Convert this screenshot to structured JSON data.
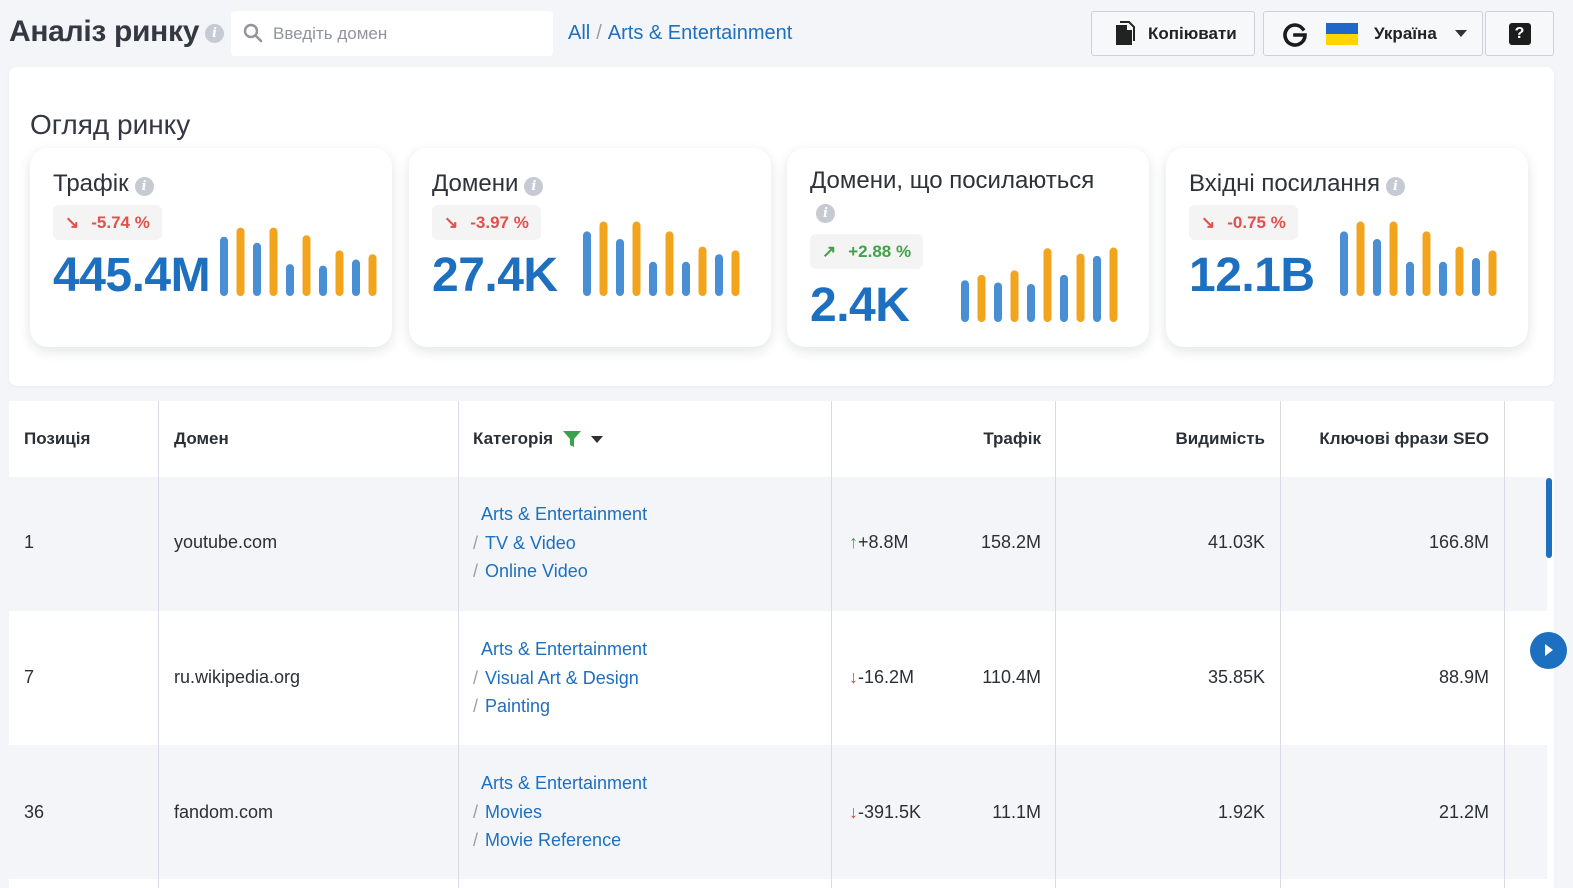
{
  "header": {
    "title": "Аналіз ринку",
    "search_placeholder": "Введіть домен",
    "breadcrumb": [
      "All",
      "Arts & Entertainment"
    ],
    "copy_label": "Копіювати",
    "region_label": "Україна",
    "help_label": "?"
  },
  "overview": {
    "title": "Огляд ринку",
    "cards": [
      {
        "title": "Трафік",
        "delta": "-5.74 %",
        "direction": "down",
        "value": "445.4M",
        "bars": [
          0.78,
          0.9,
          0.7,
          0.9,
          0.42,
          0.8,
          0.4,
          0.6,
          0.48,
          0.55
        ]
      },
      {
        "title": "Домени",
        "delta": "-3.97 %",
        "direction": "down",
        "value": "27.4K",
        "bars": [
          0.85,
          0.98,
          0.75,
          0.98,
          0.45,
          0.85,
          0.45,
          0.65,
          0.55,
          0.6
        ]
      },
      {
        "title": "Домени, що посилаються",
        "delta": "+2.88 %",
        "direction": "up",
        "value": "2.4K",
        "bars": [
          0.55,
          0.62,
          0.52,
          0.68,
          0.5,
          0.97,
          0.62,
          0.9,
          0.87,
          0.98
        ]
      },
      {
        "title": "Вхідні посилання",
        "delta": "-0.75 %",
        "direction": "down",
        "value": "12.1B",
        "bars": [
          0.85,
          0.98,
          0.75,
          0.98,
          0.45,
          0.85,
          0.45,
          0.65,
          0.5,
          0.6
        ]
      }
    ],
    "bar_colors": [
      "#4a8fd4",
      "#f2a41c"
    ]
  },
  "table": {
    "columns": [
      "Позиція",
      "Домен",
      "Категорія",
      "Трафік",
      "Видимість",
      "Ключові фрази SEO"
    ],
    "rows": [
      {
        "position": "1",
        "domain": "youtube.com",
        "categories": [
          "Arts & Entertainment",
          "TV & Video",
          "Online Video"
        ],
        "trend_dir": "up",
        "trend": "+8.8M",
        "traffic": "158.2M",
        "visibility": "41.03K",
        "keywords": "166.8M"
      },
      {
        "position": "7",
        "domain": "ru.wikipedia.org",
        "categories": [
          "Arts & Entertainment",
          "Visual Art & Design",
          "Painting"
        ],
        "trend_dir": "down",
        "trend": "-16.2M",
        "traffic": "110.4M",
        "visibility": "35.85K",
        "keywords": "88.9M"
      },
      {
        "position": "36",
        "domain": "fandom.com",
        "categories": [
          "Arts & Entertainment",
          "Movies",
          "Movie Reference"
        ],
        "trend_dir": "down",
        "trend": "-391.5K",
        "traffic": "11.1M",
        "visibility": "1.92K",
        "keywords": "21.2M"
      }
    ]
  },
  "colors": {
    "accent": "#1d6fc0",
    "positive": "#43a148",
    "negative": "#e0514c",
    "filter": "#3aa24a"
  }
}
